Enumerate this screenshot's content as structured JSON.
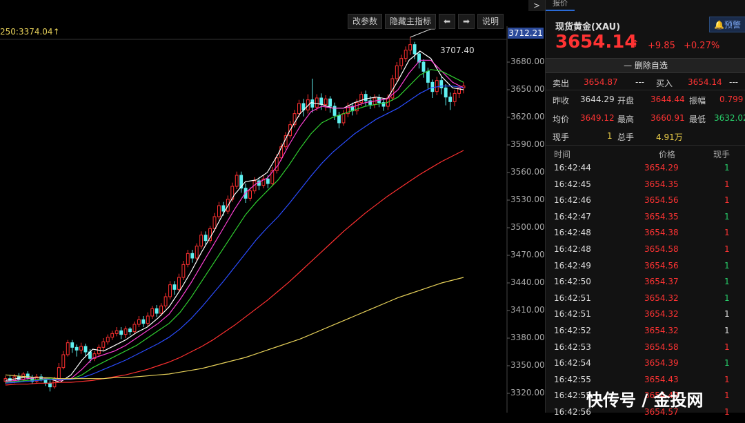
{
  "toolbar": {
    "params_label": "改参数",
    "hide_indicator_label": "隐藏主指标",
    "left_arrow": "⬅",
    "right_arrow": "➡",
    "help_label": "说明"
  },
  "ma_label": "250:3374.04",
  "ma_arrow": "↑",
  "current_price_tag": "3712.21",
  "max_marker_label": "3707.40",
  "chart_data": {
    "type": "candlestick",
    "ylim": [
      3310,
      3710
    ],
    "y_ticks": [
      "3680.00",
      "3650.00",
      "3620.00",
      "3590.00",
      "3560.00",
      "3530.00",
      "3500.00",
      "3470.00",
      "3440.00",
      "3410.00",
      "3380.00",
      "3350.00",
      "3320.00"
    ],
    "y_tick_values": [
      3680,
      3650,
      3620,
      3590,
      3560,
      3530,
      3500,
      3470,
      3440,
      3410,
      3380,
      3350,
      3320
    ],
    "candles": [
      [
        3333,
        3336,
        3330,
        3339
      ],
      [
        3336,
        3334,
        3332,
        3340
      ],
      [
        3334,
        3338,
        3331,
        3341
      ],
      [
        3338,
        3335,
        3333,
        3342
      ],
      [
        3335,
        3341,
        3333,
        3343
      ],
      [
        3341,
        3337,
        3335,
        3344
      ],
      [
        3337,
        3333,
        3330,
        3340
      ],
      [
        3333,
        3338,
        3331,
        3341
      ],
      [
        3338,
        3335,
        3333,
        3341
      ],
      [
        3335,
        3331,
        3328,
        3337
      ],
      [
        3331,
        3327,
        3322,
        3334
      ],
      [
        3327,
        3336,
        3325,
        3338
      ],
      [
        3336,
        3348,
        3334,
        3353
      ],
      [
        3348,
        3362,
        3346,
        3366
      ],
      [
        3362,
        3375,
        3360,
        3378
      ],
      [
        3375,
        3370,
        3364,
        3378
      ],
      [
        3370,
        3367,
        3360,
        3373
      ],
      [
        3367,
        3371,
        3363,
        3375
      ],
      [
        3371,
        3365,
        3360,
        3374
      ],
      [
        3365,
        3358,
        3353,
        3368
      ],
      [
        3358,
        3363,
        3355,
        3366
      ],
      [
        3363,
        3370,
        3360,
        3373
      ],
      [
        3370,
        3376,
        3366,
        3380
      ],
      [
        3376,
        3381,
        3373,
        3384
      ],
      [
        3381,
        3385,
        3378,
        3388
      ],
      [
        3385,
        3388,
        3382,
        3392
      ],
      [
        3388,
        3384,
        3379,
        3392
      ],
      [
        3384,
        3390,
        3380,
        3393
      ],
      [
        3390,
        3387,
        3383,
        3392
      ],
      [
        3387,
        3395,
        3385,
        3398
      ],
      [
        3395,
        3400,
        3392,
        3404
      ],
      [
        3400,
        3396,
        3392,
        3404
      ],
      [
        3396,
        3404,
        3393,
        3408
      ],
      [
        3404,
        3412,
        3401,
        3415
      ],
      [
        3412,
        3407,
        3403,
        3416
      ],
      [
        3407,
        3415,
        3404,
        3418
      ],
      [
        3415,
        3425,
        3412,
        3429
      ],
      [
        3425,
        3438,
        3422,
        3442
      ],
      [
        3438,
        3433,
        3427,
        3442
      ],
      [
        3433,
        3446,
        3430,
        3450
      ],
      [
        3446,
        3460,
        3443,
        3464
      ],
      [
        3460,
        3472,
        3457,
        3476
      ],
      [
        3472,
        3467,
        3462,
        3476
      ],
      [
        3467,
        3480,
        3464,
        3483
      ],
      [
        3480,
        3492,
        3477,
        3496
      ],
      [
        3492,
        3486,
        3481,
        3496
      ],
      [
        3486,
        3499,
        3483,
        3502
      ],
      [
        3499,
        3512,
        3496,
        3516
      ],
      [
        3512,
        3524,
        3509,
        3528
      ],
      [
        3524,
        3518,
        3513,
        3528
      ],
      [
        3518,
        3531,
        3515,
        3535
      ],
      [
        3531,
        3545,
        3528,
        3549
      ],
      [
        3545,
        3557,
        3542,
        3561
      ],
      [
        3557,
        3543,
        3538,
        3561
      ],
      [
        3543,
        3532,
        3527,
        3548
      ],
      [
        3532,
        3540,
        3529,
        3544
      ],
      [
        3540,
        3551,
        3537,
        3555
      ],
      [
        3551,
        3546,
        3541,
        3555
      ],
      [
        3546,
        3553,
        3543,
        3557
      ],
      [
        3553,
        3548,
        3543,
        3557
      ],
      [
        3548,
        3562,
        3545,
        3566
      ],
      [
        3562,
        3576,
        3559,
        3580
      ],
      [
        3576,
        3588,
        3573,
        3592
      ],
      [
        3588,
        3600,
        3585,
        3604
      ],
      [
        3600,
        3612,
        3597,
        3616
      ],
      [
        3612,
        3624,
        3609,
        3628
      ],
      [
        3624,
        3635,
        3620,
        3639
      ],
      [
        3635,
        3628,
        3621,
        3640
      ],
      [
        3628,
        3639,
        3624,
        3645
      ],
      [
        3639,
        3631,
        3625,
        3662
      ],
      [
        3631,
        3641,
        3627,
        3645
      ],
      [
        3641,
        3634,
        3628,
        3646
      ],
      [
        3634,
        3640,
        3627,
        3644
      ],
      [
        3640,
        3632,
        3625,
        3643
      ],
      [
        3632,
        3622,
        3617,
        3636
      ],
      [
        3622,
        3614,
        3608,
        3626
      ],
      [
        3614,
        3624,
        3611,
        3628
      ],
      [
        3624,
        3632,
        3620,
        3636
      ],
      [
        3632,
        3627,
        3622,
        3636
      ],
      [
        3627,
        3636,
        3623,
        3640
      ],
      [
        3636,
        3645,
        3632,
        3648
      ],
      [
        3645,
        3638,
        3632,
        3649
      ],
      [
        3638,
        3634,
        3629,
        3643
      ],
      [
        3634,
        3641,
        3630,
        3645
      ],
      [
        3641,
        3636,
        3631,
        3645
      ],
      [
        3636,
        3632,
        3627,
        3640
      ],
      [
        3632,
        3641,
        3628,
        3645
      ],
      [
        3641,
        3662,
        3638,
        3666
      ],
      [
        3662,
        3676,
        3659,
        3680
      ],
      [
        3676,
        3684,
        3672,
        3688
      ],
      [
        3684,
        3693,
        3680,
        3697
      ],
      [
        3693,
        3699,
        3688,
        3707
      ],
      [
        3699,
        3689,
        3683,
        3702
      ],
      [
        3689,
        3680,
        3673,
        3692
      ],
      [
        3680,
        3670,
        3663,
        3683
      ],
      [
        3670,
        3658,
        3651,
        3674
      ],
      [
        3658,
        3648,
        3641,
        3661
      ],
      [
        3648,
        3660,
        3644,
        3664
      ],
      [
        3660,
        3652,
        3645,
        3664
      ],
      [
        3652,
        3642,
        3633,
        3656
      ],
      [
        3642,
        3637,
        3628,
        3647
      ],
      [
        3637,
        3646,
        3632,
        3650
      ],
      [
        3646,
        3652,
        3641,
        3655
      ],
      [
        3652,
        3654,
        3646,
        3658
      ]
    ],
    "ma_series": [
      {
        "color": "#ffffff",
        "values": [
          3334,
          3336,
          3338,
          3337,
          3336,
          3332,
          3340,
          3356,
          3368,
          3366,
          3372,
          3378,
          3386,
          3392,
          3402,
          3414,
          3432,
          3452,
          3474,
          3494,
          3516,
          3536,
          3550,
          3552,
          3560,
          3580,
          3604,
          3624,
          3636,
          3634,
          3630,
          3630,
          3636,
          3640,
          3642,
          3640,
          3660,
          3682,
          3692,
          3684,
          3664,
          3652,
          3650
        ]
      },
      {
        "color": "#ff3fd6",
        "values": [
          3333,
          3334,
          3336,
          3337,
          3336,
          3334,
          3336,
          3346,
          3358,
          3362,
          3366,
          3372,
          3380,
          3388,
          3396,
          3406,
          3422,
          3440,
          3460,
          3480,
          3500,
          3520,
          3538,
          3548,
          3554,
          3568,
          3590,
          3610,
          3626,
          3632,
          3630,
          3630,
          3632,
          3636,
          3638,
          3640,
          3650,
          3668,
          3682,
          3682,
          3670,
          3658,
          3652
        ]
      },
      {
        "color": "#30d030",
        "values": [
          3332,
          3333,
          3334,
          3335,
          3336,
          3335,
          3335,
          3340,
          3348,
          3354,
          3360,
          3366,
          3372,
          3380,
          3388,
          3396,
          3408,
          3424,
          3442,
          3460,
          3478,
          3496,
          3514,
          3528,
          3540,
          3552,
          3568,
          3586,
          3602,
          3614,
          3620,
          3624,
          3628,
          3632,
          3634,
          3636,
          3642,
          3654,
          3666,
          3672,
          3670,
          3664,
          3658
        ]
      },
      {
        "color": "#2a4cff",
        "values": [
          3331,
          3332,
          3333,
          3334,
          3335,
          3335,
          3335,
          3337,
          3341,
          3346,
          3351,
          3356,
          3362,
          3368,
          3374,
          3381,
          3390,
          3401,
          3414,
          3428,
          3442,
          3457,
          3472,
          3487,
          3500,
          3512,
          3526,
          3541,
          3556,
          3570,
          3582,
          3592,
          3602,
          3610,
          3618,
          3624,
          3630,
          3638,
          3646,
          3652,
          3654,
          3654,
          3652
        ]
      },
      {
        "color": "#ff3030",
        "values": [
          3329,
          3330,
          3330,
          3331,
          3331,
          3332,
          3332,
          3333,
          3334,
          3336,
          3338,
          3340,
          3343,
          3346,
          3350,
          3354,
          3359,
          3365,
          3371,
          3378,
          3386,
          3394,
          3403,
          3412,
          3421,
          3431,
          3441,
          3452,
          3463,
          3474,
          3485,
          3496,
          3506,
          3516,
          3525,
          3534,
          3542,
          3550,
          3558,
          3565,
          3572,
          3578,
          3584
        ]
      },
      {
        "color": "#e8d25a",
        "values": [
          3340,
          3339,
          3338,
          3337,
          3337,
          3336,
          3336,
          3336,
          3336,
          3336,
          3337,
          3337,
          3338,
          3339,
          3340,
          3341,
          3343,
          3345,
          3347,
          3350,
          3353,
          3356,
          3359,
          3363,
          3367,
          3371,
          3375,
          3379,
          3384,
          3389,
          3394,
          3399,
          3404,
          3409,
          3414,
          3419,
          3424,
          3428,
          3432,
          3436,
          3440,
          3443,
          3446
        ]
      }
    ]
  },
  "panel": {
    "tab_label": "报价",
    "symbol_title": "现货黄金(XAU)",
    "warn_label": "预警",
    "last_price": "3654.14",
    "up_arrow": "↑",
    "change": "+9.85",
    "change_pct": "+0.27%",
    "delete_fav_label": "— 删除自选",
    "sell_label": "卖出",
    "sell_price": "3654.87",
    "sell_vol": "---",
    "buy_label": "买入",
    "buy_price": "3654.14",
    "buy_vol": "---",
    "prev_close_label": "昨收",
    "prev_close": "3644.29",
    "open_label": "开盘",
    "open": "3644.44",
    "amp_label": "振幅",
    "amp": "0.799",
    "avg_label": "均价",
    "avg": "3649.12",
    "high_label": "最高",
    "high": "3660.91",
    "low_label": "最低",
    "low": "3632.02",
    "hand_label": "现手",
    "hand": "1",
    "total_hand_label": "总手",
    "total_hand": "4.91万",
    "col_time": "时间",
    "col_price": "价格",
    "col_hand": "现手",
    "ticks": [
      {
        "time": "16:42:44",
        "price": "3654.29",
        "vol": "1",
        "color": "#28d06b"
      },
      {
        "time": "16:42:45",
        "price": "3654.35",
        "vol": "1",
        "color": "#ff3333"
      },
      {
        "time": "16:42:46",
        "price": "3654.56",
        "vol": "1",
        "color": "#ff3333"
      },
      {
        "time": "16:42:47",
        "price": "3654.35",
        "vol": "1",
        "color": "#28d06b"
      },
      {
        "time": "16:42:48",
        "price": "3654.38",
        "vol": "1",
        "color": "#ff3333"
      },
      {
        "time": "16:42:48",
        "price": "3654.58",
        "vol": "1",
        "color": "#ff3333"
      },
      {
        "time": "16:42:49",
        "price": "3654.56",
        "vol": "1",
        "color": "#28d06b"
      },
      {
        "time": "16:42:50",
        "price": "3654.37",
        "vol": "1",
        "color": "#28d06b"
      },
      {
        "time": "16:42:51",
        "price": "3654.32",
        "vol": "1",
        "color": "#28d06b"
      },
      {
        "time": "16:42:51",
        "price": "3654.32",
        "vol": "1",
        "color": "#dddddd"
      },
      {
        "time": "16:42:52",
        "price": "3654.32",
        "vol": "1",
        "color": "#dddddd"
      },
      {
        "time": "16:42:53",
        "price": "3654.58",
        "vol": "1",
        "color": "#ff3333"
      },
      {
        "time": "16:42:54",
        "price": "3654.39",
        "vol": "1",
        "color": "#28d06b"
      },
      {
        "time": "16:42:55",
        "price": "3654.43",
        "vol": "1",
        "color": "#ff3333"
      },
      {
        "time": "16:42:55",
        "price": "3654.49",
        "vol": "1",
        "color": "#ff3333"
      },
      {
        "time": "16:42:56",
        "price": "3654.57",
        "vol": "1",
        "color": "#ff3333"
      }
    ]
  },
  "watermark_text": "快传号 / 金投网",
  "colors": {
    "up": "#ff3333",
    "down": "#28d06b",
    "bg": "#000000",
    "panel_bg": "#121212"
  }
}
